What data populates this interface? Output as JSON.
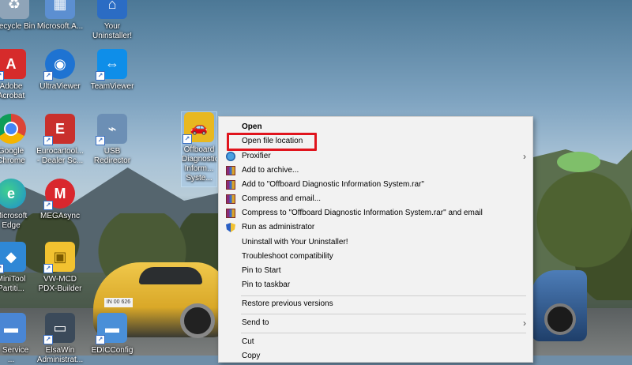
{
  "desktop": {
    "icons": [
      {
        "id": "recycle-bin",
        "label": "Recycle Bin",
        "color": "#8fa4b8"
      },
      {
        "id": "microsoft-a",
        "label": "Microsoft.A...",
        "color": "#5c8fd1"
      },
      {
        "id": "your-uninstaller",
        "label": "Your\nUninstaller!",
        "color": "#2b6cc4"
      },
      {
        "id": "adobe-acrobat",
        "label": "Adobe\nAcrobat",
        "color": "#d62b2b"
      },
      {
        "id": "ultraviewer",
        "label": "UltraViewer",
        "color": "#1e73d2"
      },
      {
        "id": "teamviewer",
        "label": "TeamViewer",
        "color": "#0e8ee9"
      },
      {
        "id": "google-chrome",
        "label": "Google\nChrome",
        "color": "#e2a72e"
      },
      {
        "id": "eurocartool",
        "label": "Eurocartool...\n- Dealer Sc...",
        "color": "#c9302c"
      },
      {
        "id": "usb-redirector",
        "label": "USB\nRedirector",
        "color": "#6c8fb5"
      },
      {
        "id": "offboard-diagnostic",
        "label": "Offboard\nDiagnostic\nInform...\nSyste...",
        "color": "#e8b820"
      },
      {
        "id": "microsoft-edge",
        "label": "Microsoft\nEdge",
        "color": "#1f8ecf"
      },
      {
        "id": "megasync",
        "label": "MEGAsync",
        "color": "#d9272e"
      },
      {
        "id": "minitool-partition",
        "label": "MiniTool\nPartiti...",
        "color": "#2f88d6"
      },
      {
        "id": "vw-mcd-pdx-builder",
        "label": "VW-MCD\nPDX-Builder",
        "color": "#f2c230"
      },
      {
        "id": "service",
        "label": "... Service\n...",
        "color": "#4a86d4"
      },
      {
        "id": "elsawin",
        "label": "ElsaWin\nAdministrat...",
        "color": "#3b4a5a"
      },
      {
        "id": "ediconfig",
        "label": "EDICConfig",
        "color": "#4a8fd8"
      }
    ],
    "car_plate": "IN 00 626"
  },
  "context_menu": {
    "items": [
      {
        "label": "Open",
        "bold": true
      },
      {
        "label": "Open file location",
        "highlighted": true
      },
      {
        "label": "Proxifier",
        "icon": "proxifier-icon",
        "submenu": true
      },
      {
        "label": "Add to archive...",
        "icon": "winrar-icon"
      },
      {
        "label": "Add to \"Offboard Diagnostic Information System.rar\"",
        "icon": "winrar-icon"
      },
      {
        "label": "Compress and email...",
        "icon": "winrar-icon"
      },
      {
        "label": "Compress to \"Offboard Diagnostic Information System.rar\" and email",
        "icon": "winrar-icon"
      },
      {
        "label": "Run as administrator",
        "icon": "uac-shield-icon"
      },
      {
        "label": "Uninstall with Your Uninstaller!"
      },
      {
        "label": "Troubleshoot compatibility"
      },
      {
        "label": "Pin to Start"
      },
      {
        "label": "Pin to taskbar"
      },
      {
        "label": "Restore previous versions"
      },
      {
        "label": "Send to",
        "submenu": true
      },
      {
        "label": "Cut"
      },
      {
        "label": "Copy"
      }
    ],
    "submenu_arrow": "›",
    "highlight_color": "#e0141d"
  }
}
